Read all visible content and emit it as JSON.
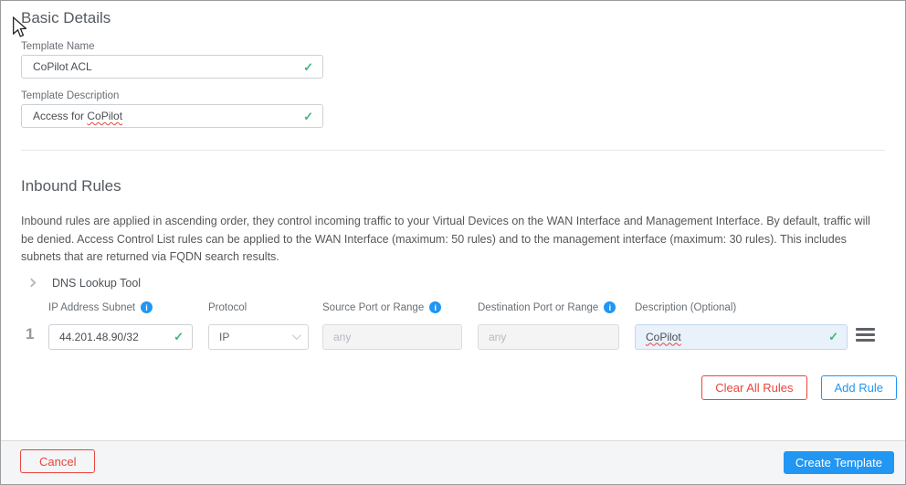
{
  "basic_details": {
    "title": "Basic Details",
    "template_name": {
      "label": "Template Name",
      "value": "CoPilot ACL"
    },
    "template_description": {
      "label": "Template Description",
      "value_prefix": "Access for ",
      "flagged_word": "CoPilot"
    }
  },
  "inbound_rules": {
    "title": "Inbound Rules",
    "intro": "Inbound rules are applied in ascending order, they control incoming traffic to your Virtual Devices on the WAN Interface and Management Interface. By default, traffic will be denied. Access Control List rules can be applied to the WAN Interface (maximum: 50 rules) and to the management interface (maximum: 30 rules). This includes subnets that are returned via FQDN search results.",
    "dns_lookup_label": "DNS Lookup Tool",
    "columns": {
      "ip": "IP Address Subnet",
      "protocol": "Protocol",
      "source": "Source Port or Range",
      "destination": "Destination Port or Range",
      "description": "Description (Optional)"
    },
    "rules": [
      {
        "index": "1",
        "ip_subnet": "44.201.48.90/32",
        "protocol": "IP",
        "source_port_placeholder": "any",
        "destination_port_placeholder": "any",
        "description": "CoPilot"
      }
    ],
    "actions": {
      "clear_all": "Clear All Rules",
      "add_rule": "Add Rule"
    }
  },
  "footer": {
    "cancel": "Cancel",
    "create_template": "Create Template"
  },
  "glyphs": {
    "check": "✓",
    "info": "i"
  },
  "colors": {
    "accent_blue": "#2196f3",
    "success_green": "#3cb878",
    "danger_red": "#e8463c",
    "description_field_bg": "#e9f1fb",
    "footer_bg": "#f4f5f6"
  }
}
